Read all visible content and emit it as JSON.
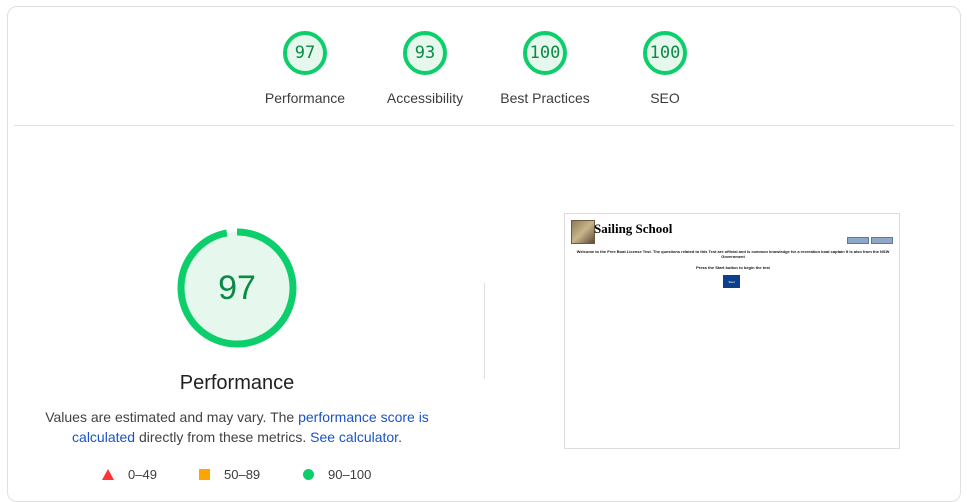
{
  "categories": [
    {
      "score": "97",
      "label": "Performance"
    },
    {
      "score": "93",
      "label": "Accessibility"
    },
    {
      "score": "100",
      "label": "Best Practices"
    },
    {
      "score": "100",
      "label": "SEO"
    }
  ],
  "main": {
    "score": "97",
    "score_value": 97,
    "title": "Performance",
    "desc_prefix": "Values are estimated and may vary. The ",
    "desc_link1": "performance score is calculated",
    "desc_middle": " directly from these metrics. ",
    "desc_link2": "See calculator",
    "desc_suffix": "."
  },
  "legend": [
    {
      "range": "0–49",
      "color": "#ff3333"
    },
    {
      "range": "50–89",
      "color": "#ffa400"
    },
    {
      "range": "90–100",
      "color": "#0cce6b"
    }
  ],
  "screenshot": {
    "site_title": "Sailing School",
    "intro": "Welcome to the Free Boat License Test. The questions related to this Test are official and is common knowledge for a recreation boat captain It is also from the NSW Government",
    "instruction": "Press the Start button to begin the test",
    "start_label": "Start"
  },
  "colors": {
    "pass": "#0cce6b",
    "pass_text": "#0b8a46",
    "link": "#1a53c8"
  }
}
